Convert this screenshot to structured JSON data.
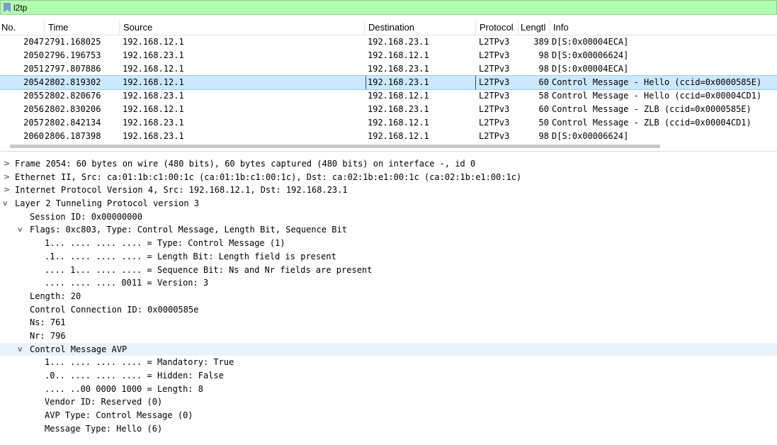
{
  "filter": {
    "value": "l2tp"
  },
  "columns": {
    "no": "No.",
    "time": "Time",
    "source": "Source",
    "destination": "Destination",
    "protocol": "Protocol",
    "length": "Lengtl",
    "info": "Info"
  },
  "packets": [
    {
      "no": "2047",
      "time": "2791.168025",
      "source": "192.168.12.1",
      "destination": "192.168.23.1",
      "protocol": "L2TPv3",
      "length": "389",
      "info": "D[S:0x00004ECA]"
    },
    {
      "no": "2050",
      "time": "2796.196753",
      "source": "192.168.23.1",
      "destination": "192.168.12.1",
      "protocol": "L2TPv3",
      "length": "98",
      "info": "D[S:0x00006624]"
    },
    {
      "no": "2051",
      "time": "2797.807886",
      "source": "192.168.12.1",
      "destination": "192.168.23.1",
      "protocol": "L2TPv3",
      "length": "98",
      "info": "D[S:0x00004ECA]"
    },
    {
      "no": "2054",
      "time": "2802.819302",
      "source": "192.168.12.1",
      "destination": "192.168.23.1",
      "protocol": "L2TPv3",
      "length": "60",
      "info": "Control Message - Hello (ccid=0x0000585E)"
    },
    {
      "no": "2055",
      "time": "2802.820676",
      "source": "192.168.23.1",
      "destination": "192.168.12.1",
      "protocol": "L2TPv3",
      "length": "58",
      "info": "Control Message - Hello (ccid=0x00004CD1)"
    },
    {
      "no": "2056",
      "time": "2802.830206",
      "source": "192.168.12.1",
      "destination": "192.168.23.1",
      "protocol": "L2TPv3",
      "length": "60",
      "info": "Control Message - ZLB (ccid=0x0000585E)"
    },
    {
      "no": "2057",
      "time": "2802.842134",
      "source": "192.168.23.1",
      "destination": "192.168.12.1",
      "protocol": "L2TPv3",
      "length": "50",
      "info": "Control Message - ZLB (ccid=0x00004CD1)"
    },
    {
      "no": "2060",
      "time": "2806.187398",
      "source": "192.168.23.1",
      "destination": "192.168.12.1",
      "protocol": "L2TPv3",
      "length": "98",
      "info": "D[S:0x00006624]"
    }
  ],
  "details": [
    {
      "twisty": ">",
      "text": "Frame 2054: 60 bytes on wire (480 bits), 60 bytes captured (480 bits) on interface -, id 0"
    },
    {
      "twisty": ">",
      "text": "Ethernet II, Src: ca:01:1b:c1:00:1c (ca:01:1b:c1:00:1c), Dst: ca:02:1b:e1:00:1c (ca:02:1b:e1:00:1c)"
    },
    {
      "twisty": ">",
      "text": "Internet Protocol Version 4, Src: 192.168.12.1, Dst: 192.168.23.1"
    },
    {
      "twisty": "v",
      "text": "Layer 2 Tunneling Protocol version 3"
    },
    {
      "twisty": "",
      "text": "Session ID: 0x00000000"
    },
    {
      "twisty": "v",
      "text": "Flags: 0xc803, Type: Control Message, Length Bit, Sequence Bit"
    },
    {
      "twisty": "",
      "text": "1... .... .... .... = Type: Control Message (1)"
    },
    {
      "twisty": "",
      "text": ".1.. .... .... .... = Length Bit: Length field is present"
    },
    {
      "twisty": "",
      "text": ".... 1... .... .... = Sequence Bit: Ns and Nr fields are present"
    },
    {
      "twisty": "",
      "text": ".... .... .... 0011 = Version: 3"
    },
    {
      "twisty": "",
      "text": "Length: 20"
    },
    {
      "twisty": "",
      "text": "Control Connection ID: 0x0000585e"
    },
    {
      "twisty": "",
      "text": "Ns: 761"
    },
    {
      "twisty": "",
      "text": "Nr: 796"
    },
    {
      "twisty": "v",
      "text": "Control Message AVP"
    },
    {
      "twisty": "",
      "text": "1... .... .... .... = Mandatory: True"
    },
    {
      "twisty": "",
      "text": ".0.. .... .... .... = Hidden: False"
    },
    {
      "twisty": "",
      "text": ".... ..00 0000 1000 = Length: 8"
    },
    {
      "twisty": "",
      "text": "Vendor ID: Reserved (0)"
    },
    {
      "twisty": "",
      "text": "AVP Type: Control Message (0)"
    },
    {
      "twisty": "",
      "text": "Message Type: Hello (6)"
    }
  ]
}
